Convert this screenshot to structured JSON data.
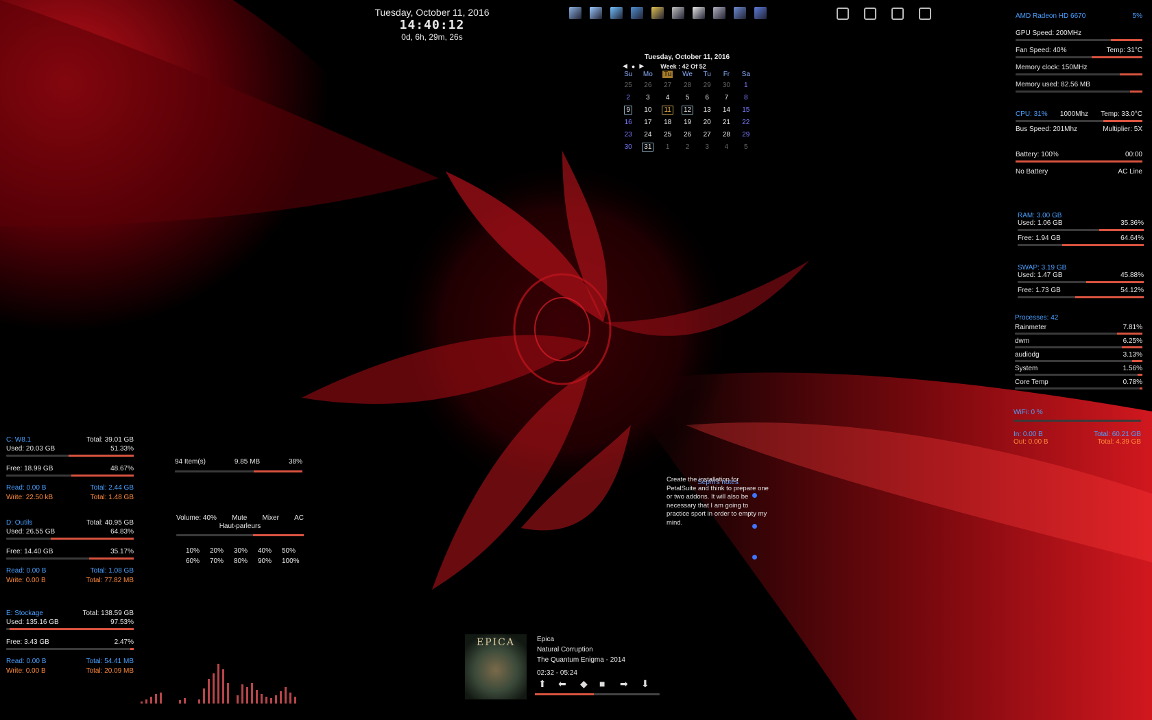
{
  "clock": {
    "date": "Tuesday, October 11, 2016",
    "time": "14:40:12",
    "uptime": "0d, 6h, 29m, 26s"
  },
  "dock": {
    "icons": [
      "computer-icon",
      "notepad-icon",
      "network-icon",
      "display-icon",
      "folder-icon",
      "taskmgr-icon",
      "window-icon",
      "printer-icon",
      "control-panel-icon",
      "settings-icon"
    ]
  },
  "window_buttons": [
    "snap-left-icon",
    "snap-center-icon",
    "snap-split-icon",
    "maximize-icon"
  ],
  "calendar": {
    "title": "Tuesday, October 11, 2016",
    "week": "Week : 42 Of 52",
    "days": [
      "Su",
      "Mo",
      "Tu",
      "We",
      "Tu",
      "Fr",
      "Sa"
    ],
    "rows": [
      [
        "25",
        "26",
        "27",
        "28",
        "29",
        "30",
        "1"
      ],
      [
        "2",
        "3",
        "4",
        "5",
        "6",
        "7",
        "8"
      ],
      [
        "9",
        "10",
        "11",
        "12",
        "13",
        "14",
        "15"
      ],
      [
        "16",
        "17",
        "18",
        "19",
        "20",
        "21",
        "22"
      ],
      [
        "23",
        "24",
        "25",
        "26",
        "27",
        "28",
        "29"
      ],
      [
        "30",
        "31",
        "1",
        "2",
        "3",
        "4",
        "5"
      ]
    ]
  },
  "gpu": {
    "name": "AMD Radeon HD 6670",
    "load": "5%",
    "speed": "GPU Speed: 200MHz",
    "fan": "Fan Speed: 40%",
    "temp": "Temp: 31°C",
    "memclock": "Memory clock: 150MHz",
    "memused": "Memory used: 82.56 MB"
  },
  "cpu": {
    "load": "CPU: 31%",
    "freq": "1000Mhz",
    "temp": "Temp: 33.0°C",
    "bus": "Bus Speed: 201Mhz",
    "mult": "Multiplier: 5X"
  },
  "battery": {
    "level": "Battery: 100%",
    "time": "00:00",
    "status": "No Battery",
    "source": "AC Line"
  },
  "ram": {
    "title": "RAM: 3.00 GB",
    "used": "Used: 1.06 GB",
    "used_pct": "35.36%",
    "free": "Free: 1.94 GB",
    "free_pct": "64.64%",
    "used_frac": 0.3536,
    "free_frac": 0.6464
  },
  "swap": {
    "title": "SWAP: 3.19 GB",
    "used": "Used: 1.47 GB",
    "used_pct": "45.88%",
    "free": "Free: 1.73 GB",
    "free_pct": "54.12%",
    "used_frac": 0.4588,
    "free_frac": 0.5412
  },
  "processes": {
    "title": "Processes: 42",
    "items": [
      {
        "name": "Rainmeter",
        "pct": "7.81%"
      },
      {
        "name": "dwm",
        "pct": "6.25%"
      },
      {
        "name": "audiodg",
        "pct": "3.13%"
      },
      {
        "name": "System",
        "pct": "1.56%"
      },
      {
        "name": "Core Temp",
        "pct": "0.78%"
      }
    ]
  },
  "wifi": {
    "title": "WiFi: 0 %",
    "in": "In: 0.00 B",
    "in_total": "Total: 60.21 GB",
    "out": "Out: 0.00 B",
    "out_total": "Total: 4.39 GB"
  },
  "drives": [
    {
      "label": "C: W8.1",
      "total": "Total: 39.01 GB",
      "used": "Used: 20.03 GB",
      "used_pct": "51.33%",
      "free": "Free: 18.99 GB",
      "free_pct": "48.67%",
      "read": "Read: 0.00 B",
      "read_total": "Total: 2.44 GB",
      "write": "Write: 22.50 kB",
      "write_total": "Total: 1.48 GB",
      "used_frac": 0.5133,
      "free_frac": 0.4867
    },
    {
      "label": "D: Outils",
      "total": "Total: 40.95 GB",
      "used": "Used: 26.55 GB",
      "used_pct": "64.83%",
      "free": "Free: 14.40 GB",
      "free_pct": "35.17%",
      "read": "Read: 0.00 B",
      "read_total": "Total: 1.08 GB",
      "write": "Write: 0.00 B",
      "write_total": "Total: 77.82 MB",
      "used_frac": 0.6483,
      "free_frac": 0.3517
    },
    {
      "label": "E: Stockage",
      "total": "Total: 138.59 GB",
      "used": "Used: 135.16 GB",
      "used_pct": "97.53%",
      "free": "Free: 3.43 GB",
      "free_pct": "2.47%",
      "read": "Read: 0.00 B",
      "read_total": "Total: 54.41 MB",
      "write": "Write: 0.00 B",
      "write_total": "Total: 20.09 MB",
      "used_frac": 0.9753,
      "free_frac": 0.0247
    }
  ],
  "recycle": {
    "items": "94 Item(s)",
    "size": "9.85 MB",
    "pct": "38%",
    "frac": 0.38
  },
  "volume": {
    "level": "Volume: 40%",
    "mute": "Mute",
    "mixer": "Mixer",
    "ac": "AC",
    "device": "Haut-parleurs",
    "frac": 0.4,
    "presets_row1": [
      "10%",
      "20%",
      "30%",
      "40%",
      "50%"
    ],
    "presets_row2": [
      "60%",
      "70%",
      "80%",
      "90%",
      "100%"
    ]
  },
  "notes": {
    "title": "Sephi's notes",
    "text": "Create the installation for PetalSuite and think to prepare one or two addons. It will also be necessary that I am going to practice sport in order to empty my mind."
  },
  "player": {
    "artist": "Epica",
    "track": "Natural Corruption",
    "album": "The Quantum Enigma - 2014",
    "time": "02:32 - 05:24",
    "progress": 0.47,
    "cover_text": "EPICA"
  },
  "colors": {
    "accent": "#d9533f",
    "label_blue": "#4aa0ff",
    "label_orange": "#ff8a3c",
    "wallpaper": "#e0101a"
  }
}
